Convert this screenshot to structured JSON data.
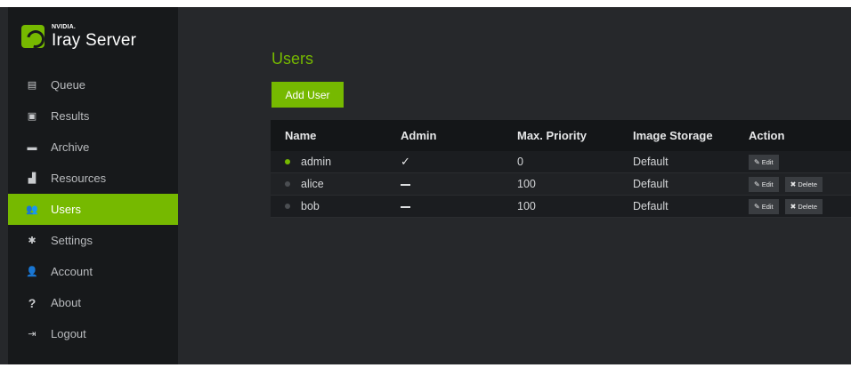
{
  "brand": {
    "company": "NVIDIA.",
    "product": "Iray Server"
  },
  "sidebar": {
    "items": [
      {
        "label": "Queue",
        "icon": "document-icon",
        "glyph": "▤",
        "active": false
      },
      {
        "label": "Results",
        "icon": "image-icon",
        "glyph": "▣",
        "active": false
      },
      {
        "label": "Archive",
        "icon": "archive-icon",
        "glyph": "▬",
        "active": false
      },
      {
        "label": "Resources",
        "icon": "bar-chart-icon",
        "glyph": "▟",
        "active": false
      },
      {
        "label": "Users",
        "icon": "users-icon",
        "glyph": "👥",
        "active": true
      },
      {
        "label": "Settings",
        "icon": "gear-icon",
        "glyph": "✱",
        "active": false
      },
      {
        "label": "Account",
        "icon": "user-icon",
        "glyph": "👤",
        "active": false
      },
      {
        "label": "About",
        "icon": "question-icon",
        "glyph": "?",
        "active": false
      },
      {
        "label": "Logout",
        "icon": "logout-icon",
        "glyph": "⇥",
        "active": false
      }
    ]
  },
  "main": {
    "title": "Users",
    "add_button": "Add User",
    "table": {
      "headers": {
        "name": "Name",
        "admin": "Admin",
        "priority": "Max. Priority",
        "storage": "Image Storage",
        "action": "Action"
      },
      "rows": [
        {
          "name": "admin",
          "online": true,
          "admin": "✓",
          "priority": "0",
          "storage": "Default",
          "edit": "Edit",
          "delete": null
        },
        {
          "name": "alice",
          "online": false,
          "admin": "—",
          "priority": "100",
          "storage": "Default",
          "edit": "Edit",
          "delete": "Delete"
        },
        {
          "name": "bob",
          "online": false,
          "admin": "—",
          "priority": "100",
          "storage": "Default",
          "edit": "Edit",
          "delete": "Delete"
        }
      ]
    }
  },
  "colors": {
    "accent": "#76b900",
    "background": "#26282b",
    "sidebar": "#17191b"
  }
}
